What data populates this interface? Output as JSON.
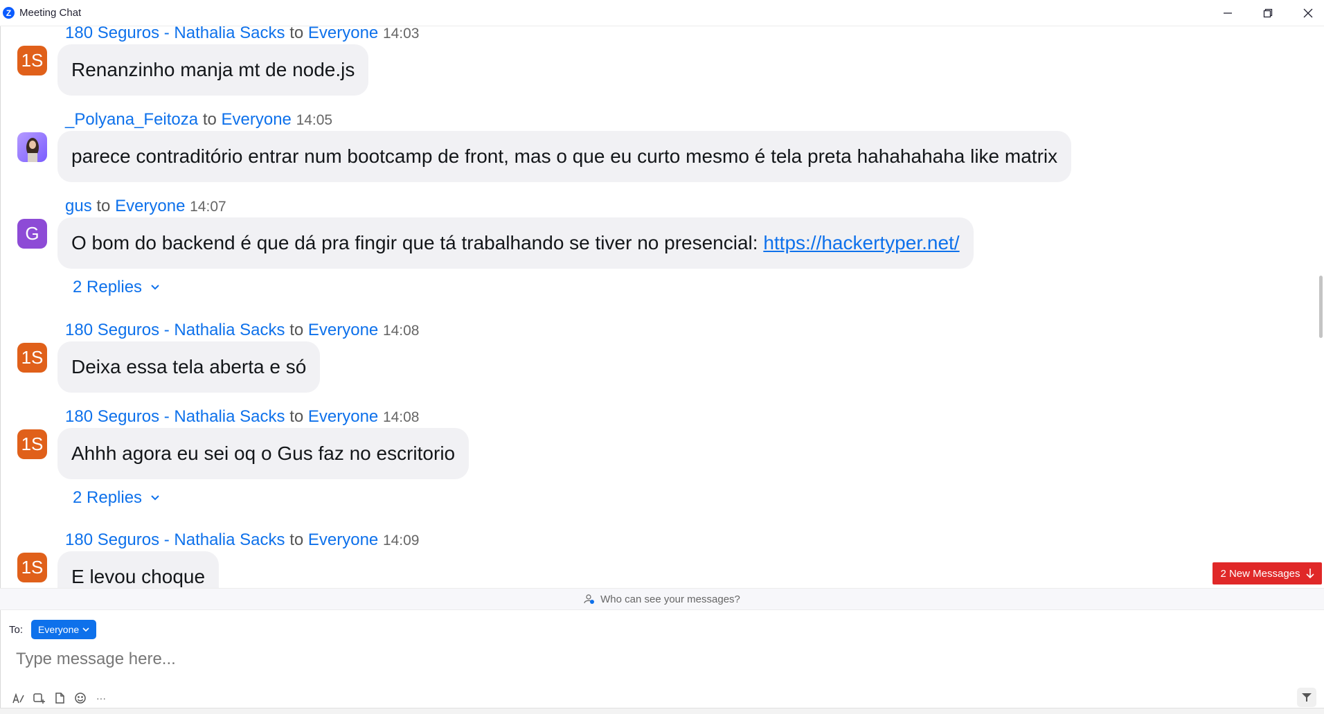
{
  "window": {
    "logo": "Z",
    "title": "Meeting Chat"
  },
  "messages": [
    {
      "sender": "180 Seguros - Nathalia Sacks",
      "to": "to",
      "recipient": "Everyone",
      "time": "14:03",
      "avatar": "1S",
      "text": "Renanzinho manja mt de node.js"
    },
    {
      "sender": "_Polyana_Feitoza",
      "to": "to",
      "recipient": "Everyone",
      "time": "14:05",
      "avatar": "",
      "text": "parece contraditório entrar num bootcamp de front, mas o que eu curto mesmo é tela preta hahahahaha like matrix"
    },
    {
      "sender": "gus",
      "to": "to",
      "recipient": "Everyone",
      "time": "14:07",
      "avatar": "G",
      "text": "O bom do backend é que dá pra fingir que tá trabalhando se tiver no presencial: ",
      "link": "https://hackertyper.net/",
      "replies": "2 Replies"
    },
    {
      "sender": "180 Seguros - Nathalia Sacks",
      "to": "to",
      "recipient": "Everyone",
      "time": "14:08",
      "avatar": "1S",
      "text": "Deixa essa tela aberta e só"
    },
    {
      "sender": "180 Seguros - Nathalia Sacks",
      "to": "to",
      "recipient": "Everyone",
      "time": "14:08",
      "avatar": "1S",
      "text": "Ahhh agora eu sei oq o Gus faz no escritorio",
      "replies": "2 Replies"
    },
    {
      "sender": "180 Seguros - Nathalia Sacks",
      "to": "to",
      "recipient": "Everyone",
      "time": "14:09",
      "avatar": "1S",
      "text": "E levou choque"
    }
  ],
  "new_messages": "2 New Messages",
  "visibility": "Who can see your messages?",
  "composer": {
    "to_label": "To:",
    "to_value": "Everyone",
    "placeholder": "Type message here..."
  },
  "toolbar": {
    "more": "···"
  },
  "colors": {
    "accent": "#0e71eb",
    "avatar_orange": "#e0601a",
    "avatar_purple": "#8d4bd6",
    "new_badge": "#e02828"
  }
}
